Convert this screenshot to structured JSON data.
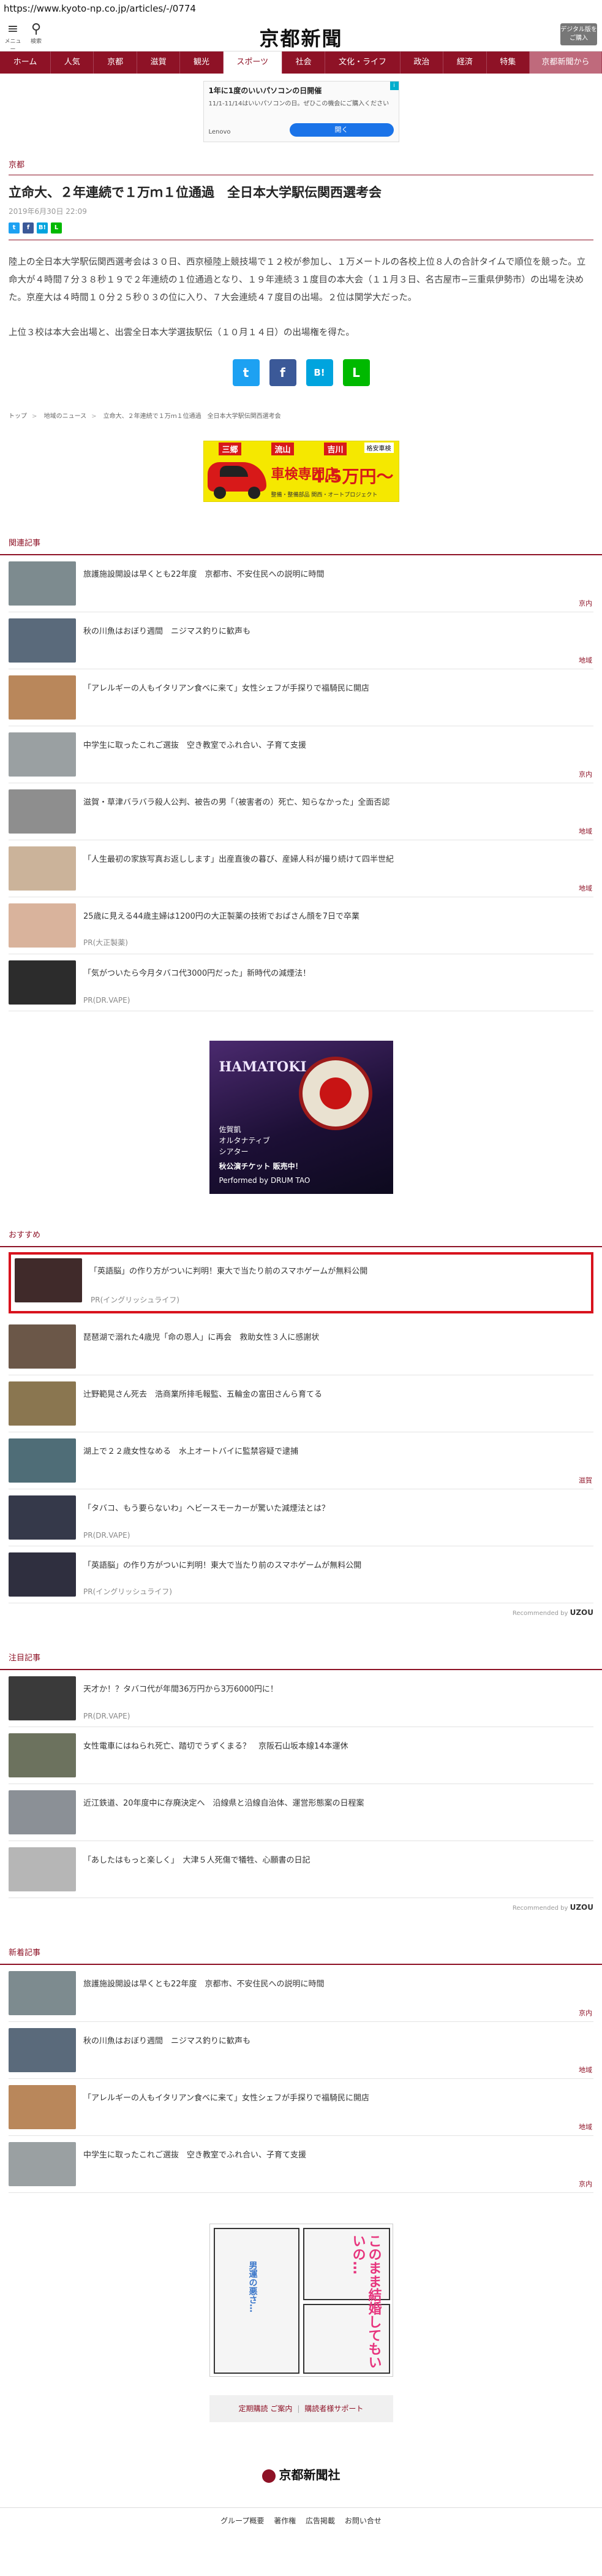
{
  "browser": {
    "url": "https://www.kyoto-np.co.jp/articles/-/0774"
  },
  "header": {
    "menu_label": "メニュー",
    "search_label": "検索",
    "logo": "京都新聞",
    "digital_button": "デジタル版をご購入"
  },
  "nav": [
    "ホーム",
    "人気",
    "京都",
    "滋賀",
    "観光",
    "スポーツ",
    "社会",
    "文化・ライフ",
    "政治",
    "経済",
    "特集",
    "京都新聞から"
  ],
  "ad_top": {
    "line1": "1年に1度のいいパソコンの日開催",
    "line2": "11/1-11/14はいいパソコンの日。ぜひこの機会にご購入ください",
    "advertiser": "Lenovo",
    "cta": "開く"
  },
  "article": {
    "category": "京都",
    "title": "立命大、２年連続で１万ｍ１位通過　全日本大学駅伝関西選考会",
    "date": "2019年6月30日 22:09",
    "paragraphs": [
      "陸上の全日本大学駅伝関西選考会は３０日、西京極陸上競技場で１２校が参加し、１万メートルの各校上位８人の合計タイムで順位を競った。立命大が４時間７分３８秒１９で２年連続の１位通過となり、１９年連続３１度目の本大会（１１月３日、名古屋市−三重県伊勢市）の出場を決めた。京産大は４時間１０分２５秒０３の位に入り、７大会連続４７度目の出場。２位は関学大だった。",
      "上位３校は本大会出場と、出雲全日本大学選抜駅伝（１０月１４日）の出場権を得た。"
    ]
  },
  "share": {
    "twitter": "t",
    "facebook": "f",
    "hatena": "B!",
    "line": "L"
  },
  "breadcrumb": [
    "トップ",
    "地域のニュース",
    "立命大、２年連続で１万ｍ１位通過　全日本大学駅伝関西選考会"
  ],
  "ad_banner": {
    "places": [
      "三郷",
      "流山",
      "吉川"
    ],
    "tax": "格安車検",
    "headline": "車検専門店",
    "price": "4.5万円〜",
    "sub": "整備・整備部品 関西・オートプロジェクト"
  },
  "related": {
    "heading": "関連記事",
    "items": [
      {
        "title": "旅護施設開設は早くとも22年度　京都市、不安住民への説明に時間",
        "tag": "京内",
        "color": "#7d8b8f"
      },
      {
        "title": "秋の川魚はおぼり週間　ニジマス釣りに歓声も",
        "tag": "地域",
        "color": "#5a6a7b"
      },
      {
        "title": "「アレルギーの人もイタリアン食べに来て」女性シェフが手探りで福騎民に開店",
        "tag": "",
        "color": "#b9875b"
      },
      {
        "title": "中学生に取ったこれご選抜　空き教室でふれ合い、子育て支援",
        "tag": "京内",
        "color": "#9aa0a2"
      },
      {
        "title": "滋賀・草津バラバラ殺人公判、被告の男「（被害者の）死亡、知らなかった」全面否認",
        "tag": "地域",
        "color": "#8e8e8e"
      },
      {
        "title": "「人生最初の家族写真お返しします」出産直後の暮び、産婦人科が撮り続けて四半世紀",
        "tag": "地域",
        "color": "#cbb39a"
      },
      {
        "title": "25歳に見える44歳主婦は1200円の大正製薬の技術でおばさん顔を7日で卒業",
        "pr": "PR(大正製薬)",
        "color": "#d9b39c"
      },
      {
        "title": "「気がついたら今月タバコ代3000円だった」新時代の減煙法！",
        "pr": "PR(DR.VAPE)",
        "color": "#2c2c2c"
      }
    ]
  },
  "ad_square": {
    "brand": "HAMATOKI",
    "info": [
      "佐賀凱",
      "オルタナティブ",
      "シアター"
    ],
    "tag": "秋公演チケット 販売中！",
    "performer": "Performed by DRUM TAO"
  },
  "recommend": {
    "heading": "おすすめ",
    "highlight": {
      "title": "「英語脳」の作り方がついに判明！東大で当たり前のスマホゲームが無料公開",
      "pr": "PR(イングリッシュライフ)",
      "color": "#402a2a"
    },
    "items": [
      {
        "title": "琵琶湖で溺れた4歳児「命の恩人」に再会　救助女性３人に感謝状",
        "tag": "",
        "color": "#6b5748"
      },
      {
        "title": "辻野範晃さん死去　浩商業所排毛報監、五輪金の富田さんら育てる",
        "tag": "",
        "color": "#8a7650"
      },
      {
        "title": "湖上で２２歳女性なめる　水上オートバイに監禁容疑で逮捕",
        "tag": "滋賀",
        "color": "#4f6d77"
      },
      {
        "title": "「タバコ、もう要らないわ」ヘビースモーカーが驚いた減煙法とは？",
        "pr": "PR(DR.VAPE)",
        "color": "#35394a"
      },
      {
        "title": "「英語脳」の作り方がついに判明！東大で当たり前のスマホゲームが無料公開",
        "pr": "PR(イングリッシュライフ)",
        "color": "#2f2f3f"
      }
    ],
    "recommended_by": "Recommended by",
    "brand": "UZOU"
  },
  "featured": {
    "heading": "注目記事",
    "items": [
      {
        "title": "天才か！？タバコ代が年間36万円から3万6000円に！",
        "pr": "PR(DR.VAPE)",
        "color": "#3a3a3a"
      },
      {
        "title": "女性電車にはねられ死亡、踏切でうずくまる？　京阪石山坂本線14本運休",
        "tag": "",
        "color": "#6c725e"
      },
      {
        "title": "近江鉄道、20年度中に存廃決定へ　沿線県と沿線自治体、運営形態案の日程案",
        "tag": "",
        "color": "#8b9096"
      },
      {
        "title": "「あしたはもっと楽しく」　大津５人死傷で犠牲、心願書の日記",
        "tag": "",
        "color": "#b6b6b6"
      }
    ],
    "recommended_by": "Recommended by",
    "brand": "UZOU"
  },
  "latest": {
    "heading": "新着記事",
    "items": [
      {
        "title": "旅護施設開設は早くとも22年度　京都市、不安住民への説明に時間",
        "tag": "京内",
        "color": "#7d8b8f"
      },
      {
        "title": "秋の川魚はおぼり週間　ニジマス釣りに歓声も",
        "tag": "地域",
        "color": "#5a6a7b"
      },
      {
        "title": "「アレルギーの人もイタリアン食べに来て」女性シェフが手探りで福騎民に開店",
        "tag": "地域",
        "color": "#b9875b"
      },
      {
        "title": "中学生に取ったこれご選抜　空き教室でふれ合い、子育て支援",
        "tag": "京内",
        "color": "#9aa0a2"
      }
    ]
  },
  "ad_manga": {
    "big": "このまま結婚してもいいの…",
    "sub": "男運の悪さ…"
  },
  "footer": {
    "links": [
      "定期購読 ご案内",
      "購読者様サポート"
    ],
    "logo": "京都新聞社",
    "bottom_links": [
      "グループ概要",
      "著作権",
      "広告掲載",
      "お問い合せ"
    ]
  },
  "colors": {
    "brand": "#8e1226",
    "highlight_border": "#d8121d"
  }
}
